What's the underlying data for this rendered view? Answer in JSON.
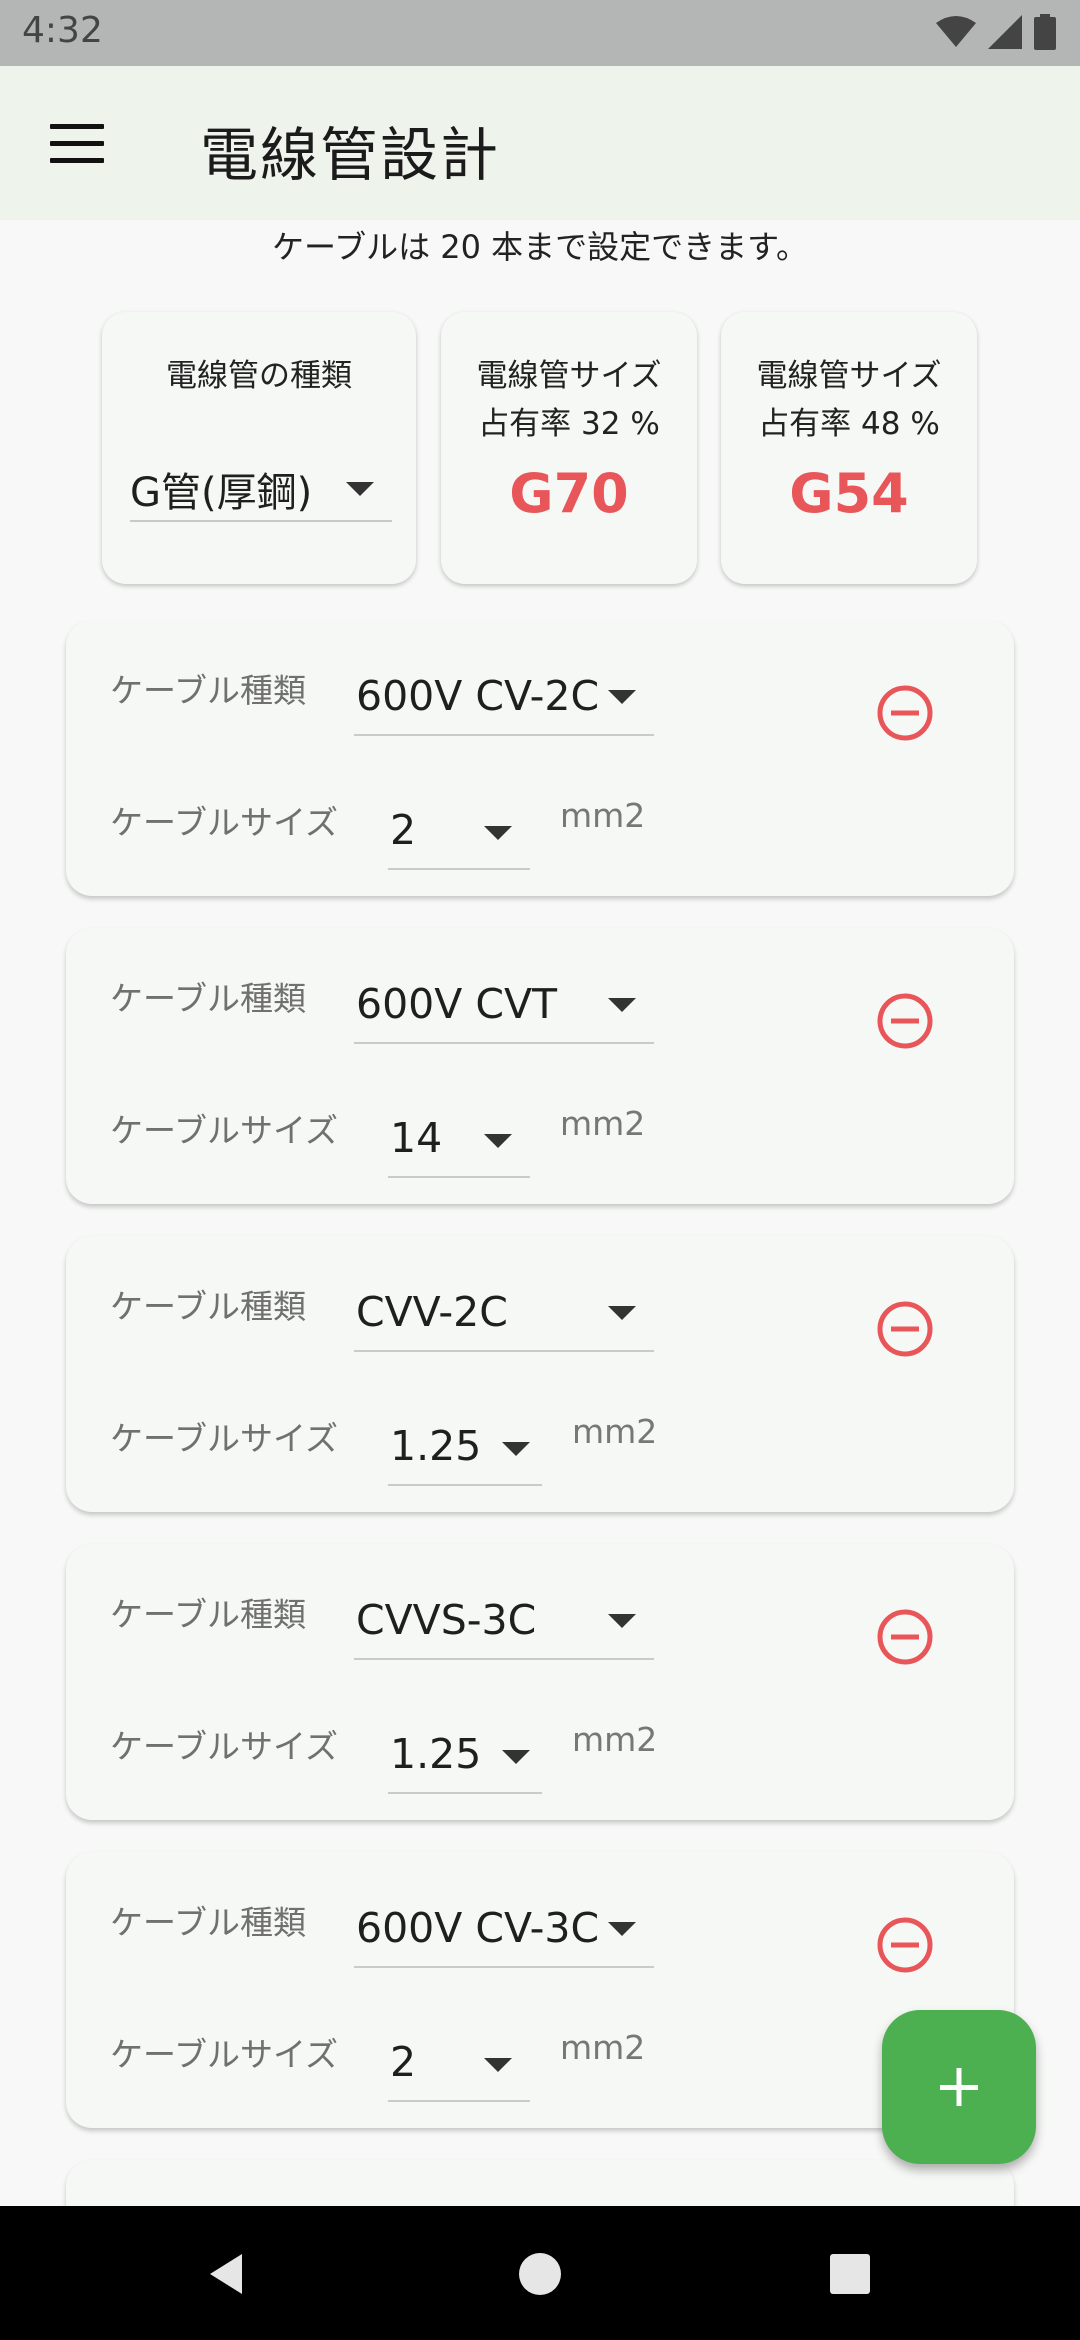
{
  "status_bar": {
    "time": "4:32",
    "icons": [
      "wifi-icon",
      "signal-icon",
      "battery-icon"
    ]
  },
  "app_bar": {
    "title": "電線管設計",
    "menu_icon": "menu-icon"
  },
  "info_text": "ケーブルは 20 本まで設定できます。",
  "summary": {
    "conduit_kind": {
      "label": "電線管の種類",
      "value": "G管(厚鋼)"
    },
    "size_1": {
      "label": "電線管サイズ",
      "ratio_label": "占有率 32 %",
      "value": "G70"
    },
    "size_2": {
      "label": "電線管サイズ",
      "ratio_label": "占有率 48 %",
      "value": "G54"
    }
  },
  "cables": [
    {
      "type_label": "ケーブル種類",
      "type": "600V CV-2C",
      "size_label": "ケーブルサイズ",
      "size": "2",
      "unit": "mm2"
    },
    {
      "type_label": "ケーブル種類",
      "type": "600V CVT",
      "size_label": "ケーブルサイズ",
      "size": "14",
      "unit": "mm2"
    },
    {
      "type_label": "ケーブル種類",
      "type": "CVV-2C",
      "size_label": "ケーブルサイズ",
      "size": "1.25",
      "unit": "mm2"
    },
    {
      "type_label": "ケーブル種類",
      "type": "CVVS-3C",
      "size_label": "ケーブルサイズ",
      "size": "1.25",
      "unit": "mm2"
    },
    {
      "type_label": "ケーブル種類",
      "type": "600V CV-3C",
      "size_label": "ケーブルサイズ",
      "size": "2",
      "unit": "mm2"
    }
  ],
  "colors": {
    "accent_red": "#e8565a",
    "fab_green": "#4caf50",
    "app_bar_bg": "#eef3ec"
  },
  "fab": {
    "icon": "plus-icon"
  },
  "nav": {
    "icons": [
      "back-icon",
      "home-icon",
      "recents-icon"
    ]
  }
}
